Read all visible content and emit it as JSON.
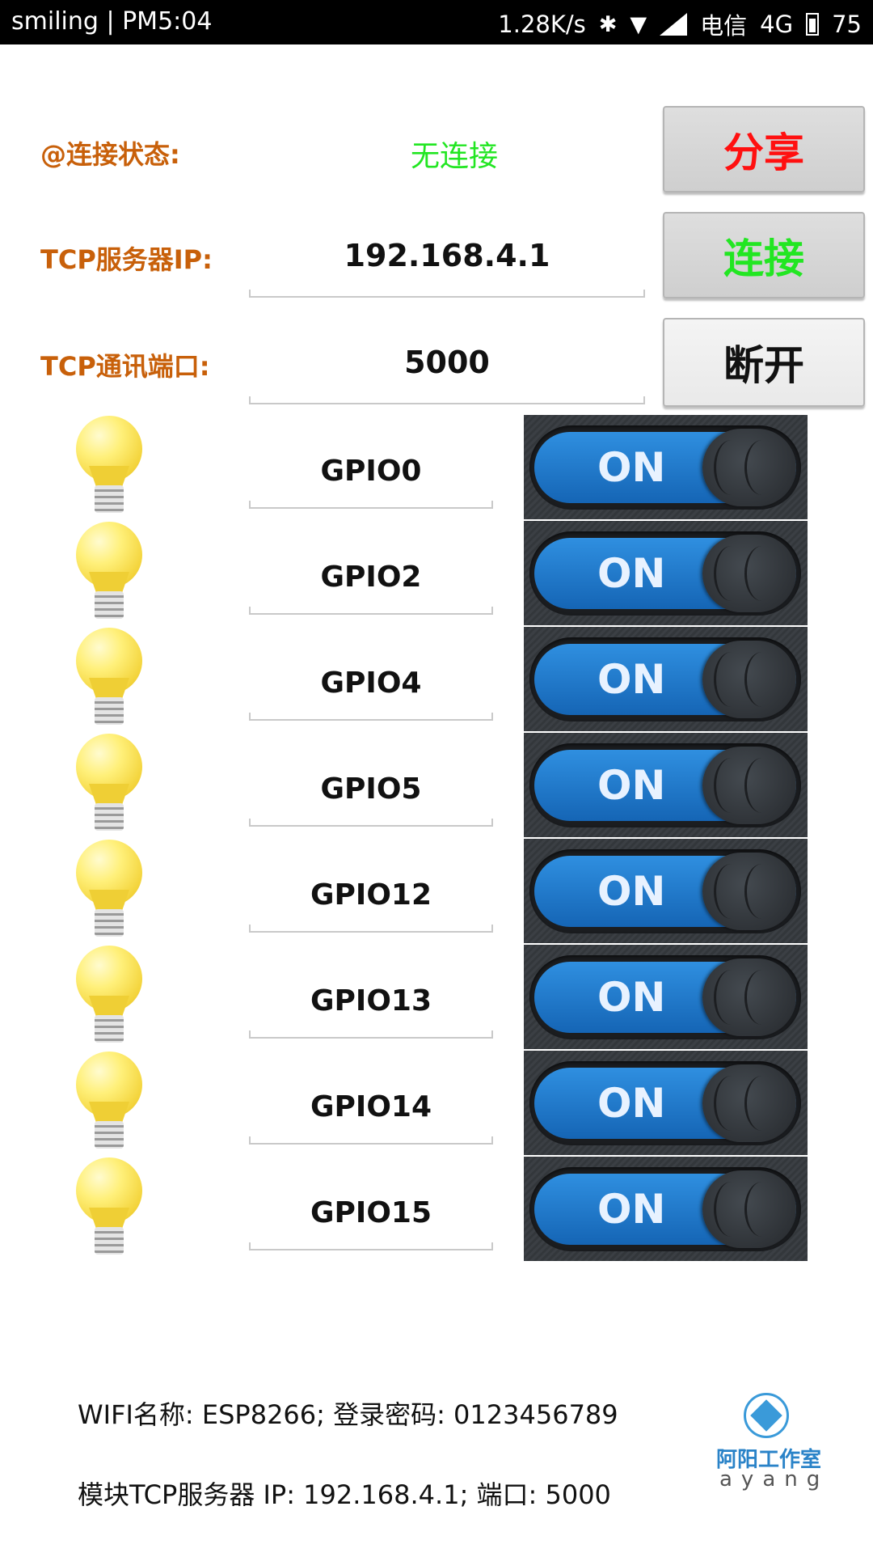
{
  "status_bar": {
    "left_text": "smiling | PM5:04",
    "speed": "1.28K/s",
    "carrier": "电信",
    "network": "4G",
    "battery": "75"
  },
  "connection": {
    "status_label": "@连接状态:",
    "status_value": "无连接",
    "status_color": "#22e622",
    "ip_label": "TCP服务器IP:",
    "ip_value": "192.168.4.1",
    "port_label": "TCP通讯端口:",
    "port_value": "5000"
  },
  "buttons": {
    "share": "分享",
    "connect": "连接",
    "disconnect": "断开"
  },
  "gpios": [
    {
      "name": "GPIO0",
      "switch": "ON"
    },
    {
      "name": "GPIO2",
      "switch": "ON"
    },
    {
      "name": "GPIO4",
      "switch": "ON"
    },
    {
      "name": "GPIO5",
      "switch": "ON"
    },
    {
      "name": "GPIO12",
      "switch": "ON"
    },
    {
      "name": "GPIO13",
      "switch": "ON"
    },
    {
      "name": "GPIO14",
      "switch": "ON"
    },
    {
      "name": "GPIO15",
      "switch": "ON"
    }
  ],
  "footer": {
    "wifi_info": "WIFI名称: ESP8266; 登录密码: 0123456789",
    "tcp_info": "模块TCP服务器 IP: 192.168.4.1; 端口: 5000",
    "logo_cn": "阿阳工作室",
    "logo_en": "ayang"
  },
  "colors": {
    "label": "#c8600a",
    "share_text": "#ff1010",
    "connect_text": "#22e622",
    "switch_blue": "#1f7fd4"
  }
}
